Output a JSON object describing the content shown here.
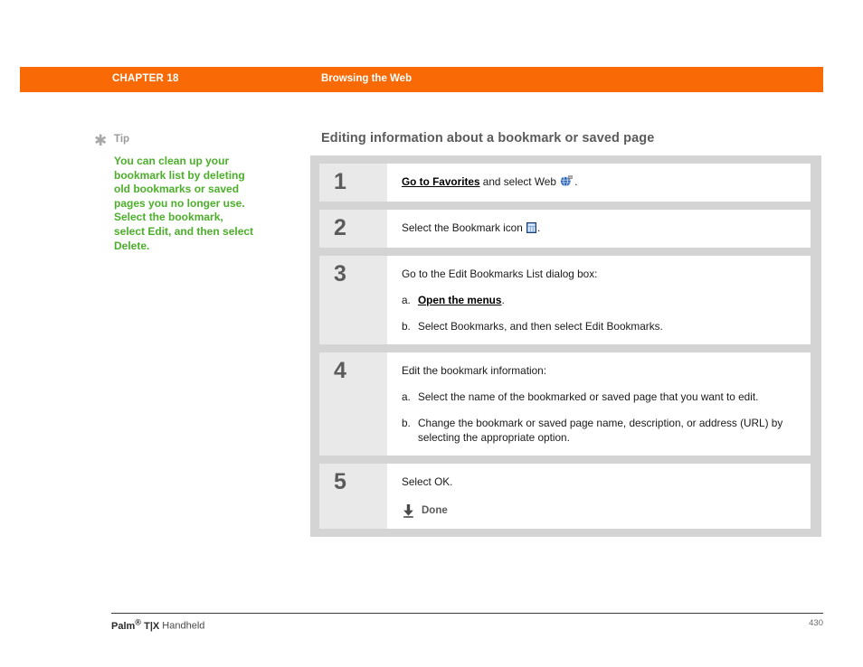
{
  "header": {
    "chapter": "CHAPTER 18",
    "section": "Browsing the Web",
    "bar_color": "#f96a06"
  },
  "tip": {
    "icon": "asterisk-icon",
    "label": "Tip",
    "text": "You can clean up your bookmark list by deleting old bookmarks or saved pages you no longer use. Select the bookmark, select Edit, and then select Delete.",
    "text_color": "#4caf2a"
  },
  "main": {
    "heading": "Editing information about a bookmark or saved page",
    "steps": [
      {
        "number": "1",
        "lead_link": "Go to Favorites",
        "lead_rest": " and select Web ",
        "lead_icon": "web-globe-icon",
        "lead_tail": ".",
        "subs": []
      },
      {
        "number": "2",
        "lead_text": "Select the Bookmark icon ",
        "lead_icon": "bookmark-list-icon",
        "lead_tail": ".",
        "subs": []
      },
      {
        "number": "3",
        "lead_text": "Go to the Edit Bookmarks List dialog box:",
        "subs": [
          {
            "marker": "a.",
            "link": "Open the menus",
            "tail": "."
          },
          {
            "marker": "b.",
            "text": "Select Bookmarks, and then select Edit Bookmarks."
          }
        ]
      },
      {
        "number": "4",
        "lead_text": "Edit the bookmark information:",
        "subs": [
          {
            "marker": "a.",
            "text": "Select the name of the bookmarked or saved page that you want to edit."
          },
          {
            "marker": "b.",
            "text": "Change the bookmark or saved page name, description, or address (URL) by selecting the appropriate option."
          }
        ]
      },
      {
        "number": "5",
        "lead_text": "Select OK.",
        "done_icon": "done-arrow-icon",
        "done_label": "Done",
        "subs": []
      }
    ]
  },
  "footer": {
    "product_bold": "Palm",
    "product_reg": "®",
    "product_model": " T|X",
    "product_rest": " Handheld",
    "page_number": "430"
  }
}
